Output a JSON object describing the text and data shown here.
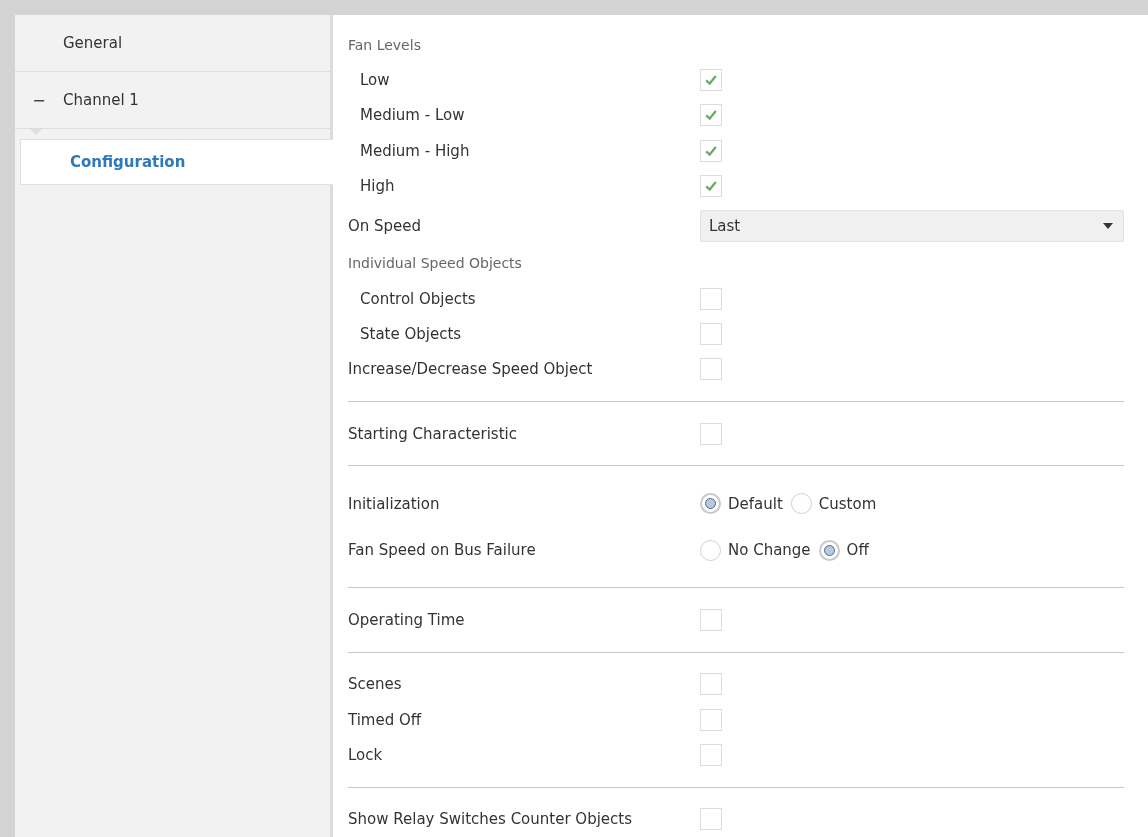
{
  "sidebar": {
    "items": [
      {
        "label": "General"
      },
      {
        "label": "Channel 1",
        "expanded": true,
        "toggle": "−",
        "children": [
          {
            "label": "Configuration",
            "selected": true
          }
        ]
      }
    ]
  },
  "settings": [
    {
      "kind": "heading",
      "label": "Fan Levels",
      "children": [
        {
          "kind": "checkbox",
          "label": "Low",
          "checked": true
        },
        {
          "kind": "checkbox",
          "label": "Medium - Low",
          "checked": true
        },
        {
          "kind": "checkbox",
          "label": "Medium - High",
          "checked": true
        },
        {
          "kind": "checkbox",
          "label": "High",
          "checked": true
        }
      ]
    },
    {
      "kind": "dropdown",
      "label": "On Speed",
      "value": "Last"
    },
    {
      "kind": "heading",
      "label": "Individual Speed Objects",
      "children": [
        {
          "kind": "checkbox",
          "label": "Control Objects",
          "checked": false
        },
        {
          "kind": "checkbox",
          "label": "State Objects",
          "checked": false
        }
      ]
    },
    {
      "kind": "checkbox",
      "label": "Increase/Decrease Speed Object",
      "checked": false
    },
    {
      "kind": "divider"
    },
    {
      "kind": "checkbox",
      "label": "Starting Characteristic",
      "checked": false
    },
    {
      "kind": "divider"
    },
    {
      "kind": "radio",
      "label": "Initialization",
      "options": [
        {
          "label": "Default",
          "selected": true
        },
        {
          "label": "Custom",
          "selected": false
        }
      ]
    },
    {
      "kind": "radio",
      "label": "Fan Speed on Bus Failure",
      "options": [
        {
          "label": "No Change",
          "selected": false
        },
        {
          "label": "Off",
          "selected": true
        }
      ]
    },
    {
      "kind": "divider"
    },
    {
      "kind": "checkbox",
      "label": "Operating Time",
      "checked": false
    },
    {
      "kind": "divider"
    },
    {
      "kind": "checkbox",
      "label": "Scenes",
      "checked": false
    },
    {
      "kind": "checkbox",
      "label": "Timed Off",
      "checked": false
    },
    {
      "kind": "checkbox",
      "label": "Lock",
      "checked": false
    },
    {
      "kind": "divider"
    },
    {
      "kind": "checkbox",
      "label": "Show Relay Switches Counter Objects",
      "checked": false
    }
  ]
}
